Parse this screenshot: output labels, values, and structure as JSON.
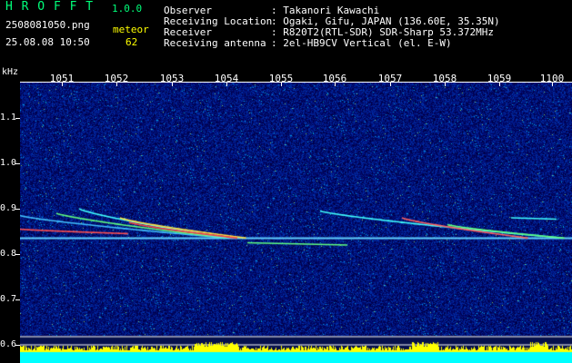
{
  "header": {
    "app_name": "H R O F F T",
    "version": "1.0.0",
    "filename": "2508081050.png",
    "datetime": "25.08.08 10:50",
    "meteor_label": "meteor",
    "meteor_count": "62",
    "info": [
      {
        "key": "Observer",
        "value": ": Takanori Kawachi"
      },
      {
        "key": "Receiving Location",
        "value": ": Ogaki, Gifu, JAPAN (136.60E, 35.35N)"
      },
      {
        "key": "Receiver",
        "value": ": R820T2(RTL-SDR) SDR-Sharp 53.372MHz"
      },
      {
        "key": "Receiving antenna",
        "value": ": 2el-HB9CV Vertical (el. E-W)"
      }
    ]
  },
  "axis": {
    "y_unit": "kHz",
    "y_ticks": [
      "1.1",
      "1.0",
      "0.9",
      "0.8",
      "0.7",
      "0.6"
    ],
    "x_ticks": [
      "1051",
      "1052",
      "1053",
      "1054",
      "1055",
      "1056",
      "1057",
      "1058",
      "1059",
      "1100"
    ]
  },
  "colors": {
    "background_noise": "#0a1a8c",
    "header_green": "#00ff7a",
    "header_yellow": "#ffff00",
    "amplitude_cyan": "#00ffff",
    "amplitude_yellow": "#ffff00"
  }
}
